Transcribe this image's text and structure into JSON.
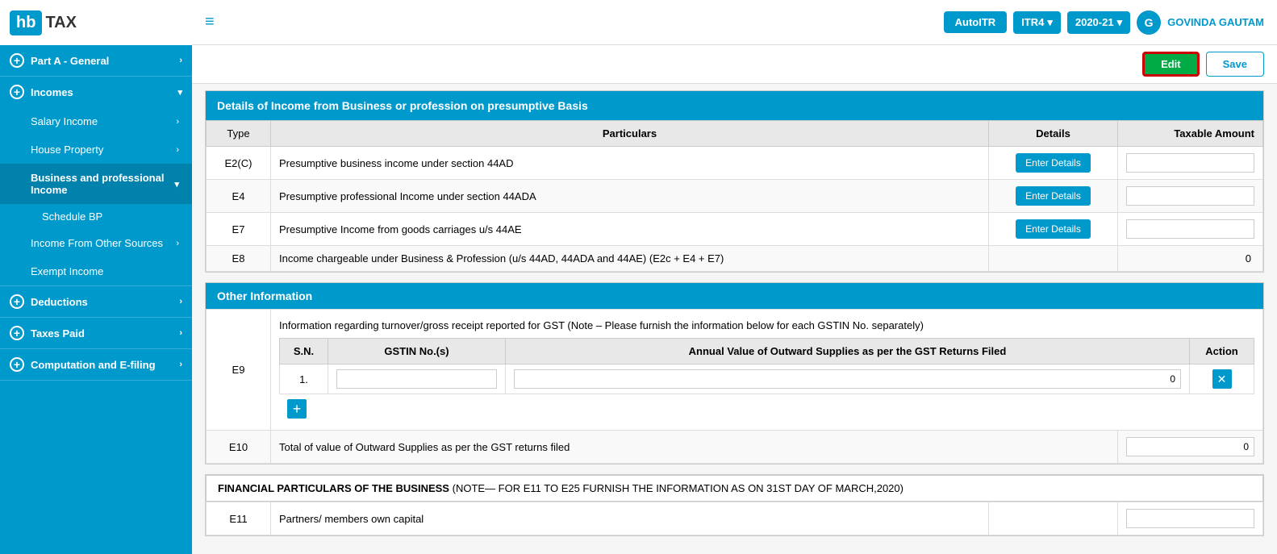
{
  "logo": {
    "hb": "hb",
    "tax": "TAX"
  },
  "topbar": {
    "hamburger": "≡",
    "autoitr_label": "AutoITR",
    "itr4_label": "ITR4",
    "year_label": "2020-21",
    "user_initial": "G",
    "user_name": "GOVINDA GAUTAM",
    "dropdown_arrow": "▾"
  },
  "actions": {
    "edit_label": "Edit",
    "save_label": "Save"
  },
  "sidebar": {
    "part_a": "Part A - General",
    "incomes": "Incomes",
    "salary_income": "Salary Income",
    "house_property": "House Property",
    "business_income": "Business and professional Income",
    "schedule_bp": "Schedule BP",
    "income_other": "Income From Other Sources",
    "exempt_income": "Exempt Income",
    "deductions": "Deductions",
    "taxes_paid": "Taxes Paid",
    "computation": "Computation and E-filing"
  },
  "main_section": {
    "title": "Details of Income from Business or profession on presumptive Basis",
    "table_headers": {
      "type": "Type",
      "particulars": "Particulars",
      "details": "Details",
      "taxable_amount": "Taxable Amount"
    },
    "rows": [
      {
        "type": "E2(C)",
        "particulars": "Presumptive business income under section 44AD",
        "has_btn": true,
        "btn_label": "Enter Details",
        "amount": ""
      },
      {
        "type": "E4",
        "particulars": "Presumptive professional Income under section 44ADA",
        "has_btn": true,
        "btn_label": "Enter Details",
        "amount": ""
      },
      {
        "type": "E7",
        "particulars": "Presumptive Income from goods carriages u/s 44AE",
        "has_btn": true,
        "btn_label": "Enter Details",
        "amount": ""
      },
      {
        "type": "E8",
        "particulars": "Income chargeable under Business & Profession (u/s 44AD, 44ADA and 44AE) (E2c + E4 + E7)",
        "has_btn": false,
        "btn_label": "",
        "amount": "0"
      }
    ]
  },
  "other_info": {
    "title": "Other Information",
    "e9_label": "E9",
    "e9_description": "Information regarding turnover/gross receipt reported for GST (Note – Please furnish the information below for each GSTIN No. separately)",
    "gst_table_headers": {
      "sn": "S.N.",
      "gstin": "GSTIN No.(s)",
      "annual_value": "Annual Value of Outward Supplies as per the GST Returns Filed",
      "action": "Action"
    },
    "gst_rows": [
      {
        "sn": "1.",
        "gstin_value": "",
        "annual_value": "0"
      }
    ],
    "add_btn": "+",
    "e10_label": "E10",
    "e10_description": "Total of value of Outward Supplies as per the GST returns filed",
    "e10_value": "0"
  },
  "financial": {
    "header": "FINANCIAL PARTICULARS OF THE BUSINESS",
    "note": "(NOTE— For E11 to E25 furnish the information as on 31st day of March,2020)",
    "e11_label": "E11",
    "e11_description": "Partners/ members own capital"
  }
}
